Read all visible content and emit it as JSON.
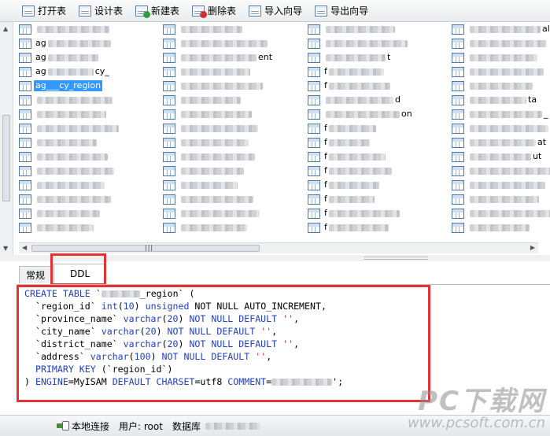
{
  "toolbar": {
    "items": [
      {
        "label": "打开表",
        "icon": "open-table-icon",
        "badge": ""
      },
      {
        "label": "设计表",
        "icon": "design-table-icon",
        "badge": ""
      },
      {
        "label": "新建表",
        "icon": "new-table-icon",
        "badge": "#2e9b3a"
      },
      {
        "label": "删除表",
        "icon": "delete-table-icon",
        "badge": "#d62b2b"
      },
      {
        "label": "导入向导",
        "icon": "import-wizard-icon",
        "badge": ""
      },
      {
        "label": "导出向导",
        "icon": "export-wizard-icon",
        "badge": ""
      }
    ]
  },
  "table_list": {
    "columns": [
      [
        {
          "text": ""
        },
        {
          "text": "ag"
        },
        {
          "text": "ag"
        },
        {
          "text": "ag",
          "suffix": "cy_"
        },
        {
          "text": "ag___cy_region",
          "selected": true
        },
        {
          "text": ""
        },
        {
          "text": ""
        },
        {
          "text": ""
        },
        {
          "text": ""
        },
        {
          "text": ""
        },
        {
          "text": ""
        },
        {
          "text": ""
        },
        {
          "text": ""
        },
        {
          "text": ""
        },
        {
          "text": ""
        }
      ],
      [
        {
          "text": ""
        },
        {
          "text": ""
        },
        {
          "text": "",
          "suffix": "ent"
        },
        {
          "text": ""
        },
        {
          "text": ""
        },
        {
          "text": ""
        },
        {
          "text": ""
        },
        {
          "text": ""
        },
        {
          "text": ""
        },
        {
          "text": ""
        },
        {
          "text": ""
        },
        {
          "text": ""
        },
        {
          "text": ""
        },
        {
          "text": ""
        },
        {
          "text": ""
        }
      ],
      [
        {
          "text": ""
        },
        {
          "text": ""
        },
        {
          "text": "",
          "suffix": "t"
        },
        {
          "text": "f"
        },
        {
          "text": "f"
        },
        {
          "text": "",
          "suffix": "d"
        },
        {
          "text": "",
          "suffix": "on"
        },
        {
          "text": "f"
        },
        {
          "text": "f"
        },
        {
          "text": "f"
        },
        {
          "text": "f"
        },
        {
          "text": "f"
        },
        {
          "text": "f"
        },
        {
          "text": "f"
        },
        {
          "text": "f"
        }
      ],
      [
        {
          "text": "",
          "suffix": "alu"
        },
        {
          "text": ""
        },
        {
          "text": ""
        },
        {
          "text": ""
        },
        {
          "text": ""
        },
        {
          "text": "",
          "suffix": "ta"
        },
        {
          "text": "",
          "suffix": "_"
        },
        {
          "text": ""
        },
        {
          "text": "",
          "suffix": "at"
        },
        {
          "text": "",
          "suffix": "ut"
        },
        {
          "text": "",
          "suffix": "a"
        },
        {
          "text": ""
        },
        {
          "text": ""
        },
        {
          "text": "",
          "suffix": "id"
        },
        {
          "text": ""
        }
      ]
    ]
  },
  "tabs": [
    {
      "label": "常规",
      "active": false
    },
    {
      "label": "DDL",
      "active": true
    }
  ],
  "ddl": {
    "lines": [
      [
        {
          "t": "CREATE TABLE ",
          "c": "kw"
        },
        {
          "t": "`"
        },
        {
          "t": "       ",
          "c": "blur"
        },
        {
          "t": "_region` ("
        }
      ],
      [
        {
          "t": "  `region_id` "
        },
        {
          "t": "int",
          "c": "kw"
        },
        {
          "t": "("
        },
        {
          "t": "10",
          "c": "num"
        },
        {
          "t": ") "
        },
        {
          "t": "unsigned",
          "c": "kw"
        },
        {
          "t": " NOT NULL AUTO_INCREMENT,"
        }
      ],
      [
        {
          "t": "  `province_name` "
        },
        {
          "t": "varchar",
          "c": "kw"
        },
        {
          "t": "("
        },
        {
          "t": "20",
          "c": "num"
        },
        {
          "t": ") "
        },
        {
          "t": "NOT NULL DEFAULT",
          "c": "kw"
        },
        {
          "t": " "
        },
        {
          "t": "''",
          "c": "st"
        },
        {
          "t": ","
        }
      ],
      [
        {
          "t": "  `city_name` "
        },
        {
          "t": "varchar",
          "c": "kw"
        },
        {
          "t": "("
        },
        {
          "t": "20",
          "c": "num"
        },
        {
          "t": ") "
        },
        {
          "t": "NOT NULL DEFAULT",
          "c": "kw"
        },
        {
          "t": " "
        },
        {
          "t": "''",
          "c": "st"
        },
        {
          "t": ","
        }
      ],
      [
        {
          "t": "  `district_name` "
        },
        {
          "t": "varchar",
          "c": "kw"
        },
        {
          "t": "("
        },
        {
          "t": "20",
          "c": "num"
        },
        {
          "t": ") "
        },
        {
          "t": "NOT NULL DEFAULT",
          "c": "kw"
        },
        {
          "t": " "
        },
        {
          "t": "''",
          "c": "st"
        },
        {
          "t": ","
        }
      ],
      [
        {
          "t": "  `address` "
        },
        {
          "t": "varchar",
          "c": "kw"
        },
        {
          "t": "("
        },
        {
          "t": "100",
          "c": "num"
        },
        {
          "t": ") "
        },
        {
          "t": "NOT NULL DEFAULT",
          "c": "kw"
        },
        {
          "t": " "
        },
        {
          "t": "''",
          "c": "st"
        },
        {
          "t": ","
        }
      ],
      [
        {
          "t": "  "
        },
        {
          "t": "PRIMARY KEY",
          "c": "kw"
        },
        {
          "t": " (`region_id`)"
        }
      ],
      [
        {
          "t": ") "
        },
        {
          "t": "ENGINE",
          "c": "kw"
        },
        {
          "t": "=MyISAM "
        },
        {
          "t": "DEFAULT CHARSET",
          "c": "kw"
        },
        {
          "t": "=utf8 "
        },
        {
          "t": "COMMENT",
          "c": "kw"
        },
        {
          "t": "="
        },
        {
          "t": "           ",
          "c": "blur"
        },
        {
          "t": "';"
        }
      ]
    ]
  },
  "status": {
    "connection_label": "本地连接",
    "user_label": "用户: root",
    "db_label": "数据库"
  },
  "watermark": {
    "big": "PC下载网",
    "small": "www.pcsoft.com.cn"
  },
  "colors": {
    "highlight_box": "#e53333",
    "selection": "#3399ff",
    "keyword": "#1f3fc8",
    "string": "#c51a4a"
  }
}
